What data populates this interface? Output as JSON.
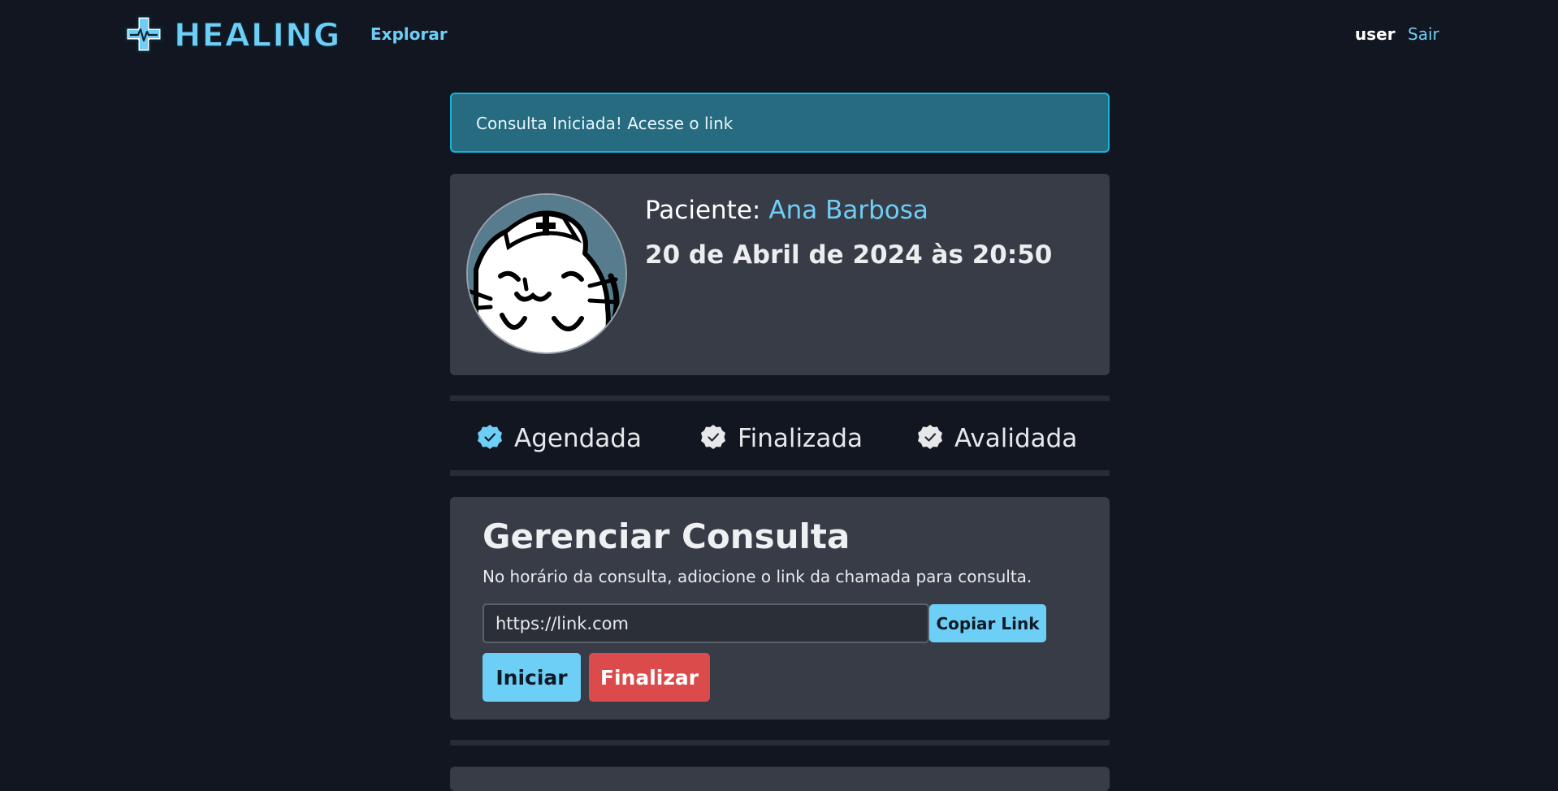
{
  "header": {
    "brand": "HEALING",
    "nav_explore": "Explorar",
    "user": "user",
    "logout": "Sair"
  },
  "alert": {
    "message": "Consulta Iniciada! Acesse o link"
  },
  "patient": {
    "label": "Paciente:",
    "name": "Ana Barbosa",
    "datetime": "20 de Abril de 2024 às 20:50"
  },
  "status": {
    "steps": [
      {
        "label": "Agendada",
        "state": "done",
        "icon": "check-badge-icon",
        "color": "#6ecff6"
      },
      {
        "label": "Finalizada",
        "state": "pending",
        "icon": "check-badge-icon",
        "color": "#e6e8ea"
      },
      {
        "label": "Avalidada",
        "state": "pending",
        "icon": "check-badge-icon",
        "color": "#e6e8ea"
      }
    ]
  },
  "manage": {
    "title": "Gerenciar Consulta",
    "description": "No horário da consulta, adiocione o link da chamada para consulta.",
    "link_value": "https://link.com",
    "copy_label": "Copiar Link",
    "start_label": "Iniciar",
    "finish_label": "Finalizar"
  },
  "colors": {
    "background": "#121620",
    "card": "#373c47",
    "accent": "#6ecff6",
    "danger": "#dc4b4b",
    "alert_bg": "#266b80"
  }
}
